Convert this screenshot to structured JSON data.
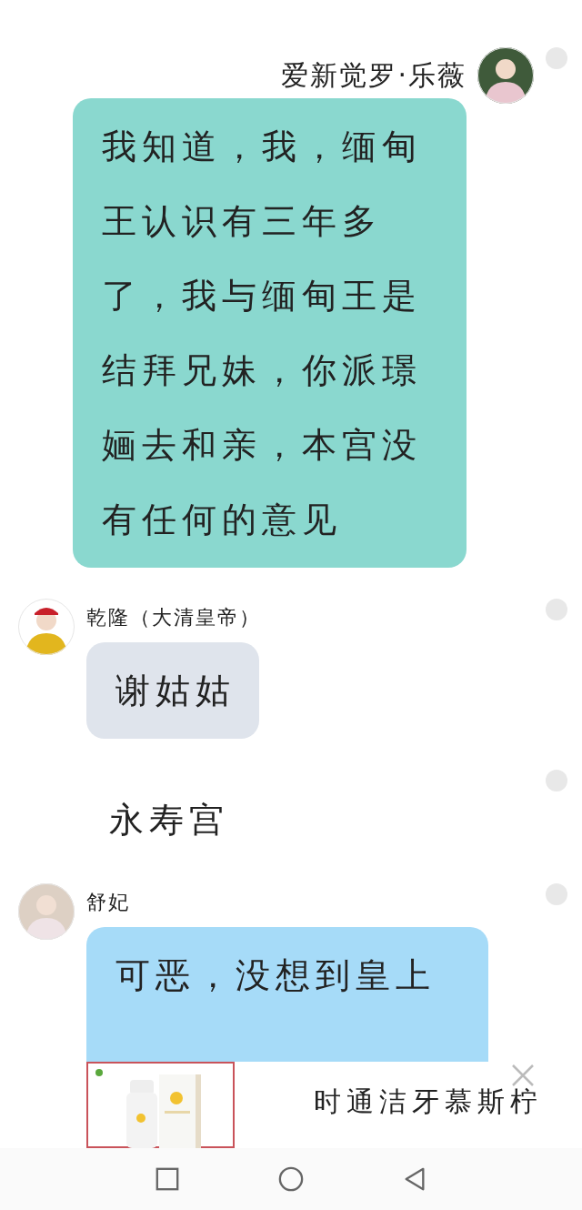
{
  "messages": [
    {
      "kind": "message",
      "outgoing": true,
      "sender": "爱新觉罗·乐薇",
      "text": "我知道，我，缅甸王认识有三年多了，我与缅甸王是结拜兄妹，你派璟婳去和亲，本宫没有任何的意见",
      "color": "#8ad8cf",
      "selected": false
    },
    {
      "kind": "message",
      "outgoing": false,
      "sender": "乾隆（大清皇帝）",
      "text": "谢姑姑",
      "color": "#dfe4ec",
      "selected": false
    },
    {
      "kind": "notice",
      "text": "永寿宫",
      "selected": false
    },
    {
      "kind": "message",
      "outgoing": false,
      "sender": "舒妃",
      "text": "可恶，没想到皇上",
      "color": "#a6dbf8",
      "selected": false
    }
  ],
  "ad": {
    "title": "时通洁牙慕斯柠"
  }
}
